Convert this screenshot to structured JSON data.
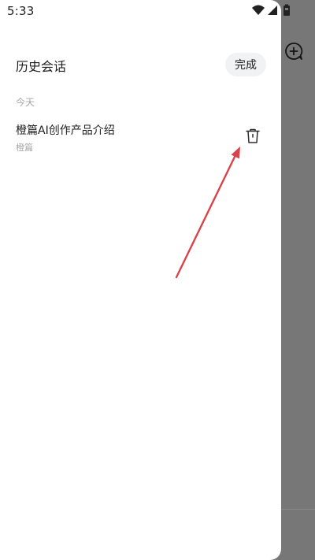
{
  "status_bar": {
    "time": "5:33",
    "icons": [
      "wifi-icon",
      "cellular-signal-icon",
      "battery-icon"
    ]
  },
  "drawer": {
    "title": "历史会话",
    "done_label": "完成",
    "sections": [
      {
        "label": "今天",
        "items": [
          {
            "title": "橙篇AI创作产品介绍",
            "subtitle": "橙篇",
            "action_icon": "trash-icon"
          }
        ]
      }
    ]
  },
  "background_app": {
    "icons": [
      "new-chat-icon"
    ]
  },
  "colors": {
    "annotation_arrow": "#d9434b",
    "scrim": "#777777",
    "done_button_bg": "#f1f2f4"
  }
}
